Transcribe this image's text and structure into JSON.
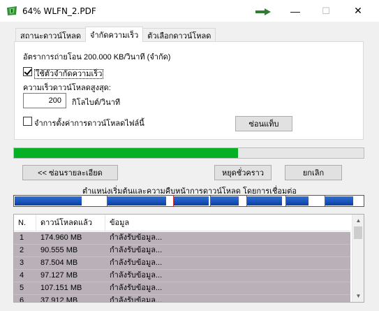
{
  "window": {
    "title": "64% WLFN_2.PDF",
    "minimize_glyph": "—",
    "maximize_glyph": "☐",
    "close_glyph": "✕",
    "icons": [
      "idm-app-icon",
      "green-arrow-icon"
    ]
  },
  "tabs": [
    {
      "label": "สถานะดาวน์โหลด"
    },
    {
      "label": "จำกัดความเร็ว",
      "active": true
    },
    {
      "label": "ตัวเลือกดาวน์โหลด"
    }
  ],
  "limits": {
    "transfer_rate_text": "อัตราการถ่ายโอน  200.000  KB/วินาที  (จำกัด)",
    "use_limit_label": "ใช้ตัวจำกัดความเร็ว",
    "use_limit_checked": true,
    "max_speed_label": "ความเร็วดาวน์โหลดสูงสุด:",
    "max_speed_value": "200",
    "unit_label": "กิโลไบต์/วินาที",
    "remember_label": "จำการตั้งค่าการดาวน์โหลดไฟล์นี้",
    "remember_checked": false,
    "hide_button": "ซ่อนแท็บ"
  },
  "progress": {
    "percent": 64,
    "color": "#06b025"
  },
  "buttons": {
    "hide_details": "<< ซ่อนรายละเอียด",
    "pause": "หยุดชั่วคราว",
    "cancel": "ยกเลิก"
  },
  "segments_caption": "ตำแหน่งเริ่มต้นและความคืบหน้าการดาวน์โหลด โดยการเชื่อมต่อ",
  "table": {
    "columns": [
      "N.",
      "ดาวน์โหลดแล้ว",
      "ข้อมูล"
    ],
    "rows": [
      {
        "n": "1",
        "downloaded": "174.960  MB",
        "info": "กำลังรับข้อมูล..."
      },
      {
        "n": "2",
        "downloaded": "90.555  MB",
        "info": "กำลังรับข้อมูล..."
      },
      {
        "n": "3",
        "downloaded": "87.504  MB",
        "info": "กำลังรับข้อมูล..."
      },
      {
        "n": "4",
        "downloaded": "97.127  MB",
        "info": "กำลังรับข้อมูล..."
      },
      {
        "n": "5",
        "downloaded": "107.151  MB",
        "info": "กำลังรับข้อมูล..."
      },
      {
        "n": "6",
        "downloaded": "37.912  MB",
        "info": "กำลังรับข้อมูล..."
      }
    ],
    "row_color": "#b9b1b7"
  },
  "scrollbar": {
    "up_glyph": "▲",
    "down_glyph": "▼"
  }
}
